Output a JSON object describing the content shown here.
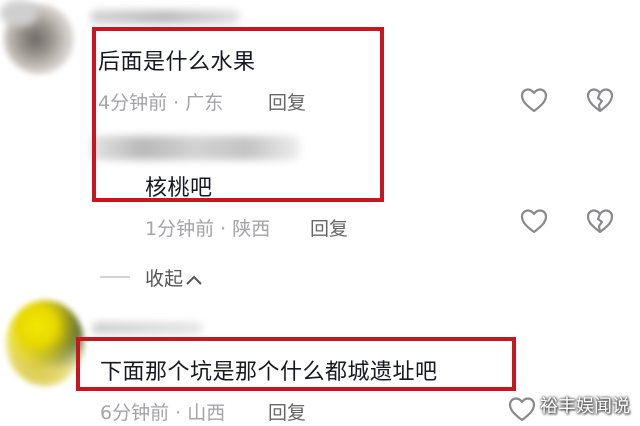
{
  "comments": [
    {
      "text": "后面是什么水果",
      "meta": "4分钟前 · 广东",
      "reply_label": "回复"
    },
    {
      "text": "核桃吧",
      "meta": "1分钟前 · 陕西",
      "reply_label": "回复"
    },
    {
      "text": "下面那个坑是那个什么都城遗址吧",
      "meta": "6分钟前 · 山西",
      "reply_label": "回复"
    }
  ],
  "collapse_label": "收起",
  "collapse_icon": "chevron-up-icon",
  "like_icon": "heart-outline-icon",
  "dislike_icon": "broken-heart-icon",
  "highlight_color": "#c8161e",
  "watermark": "裕丰娱闻说"
}
